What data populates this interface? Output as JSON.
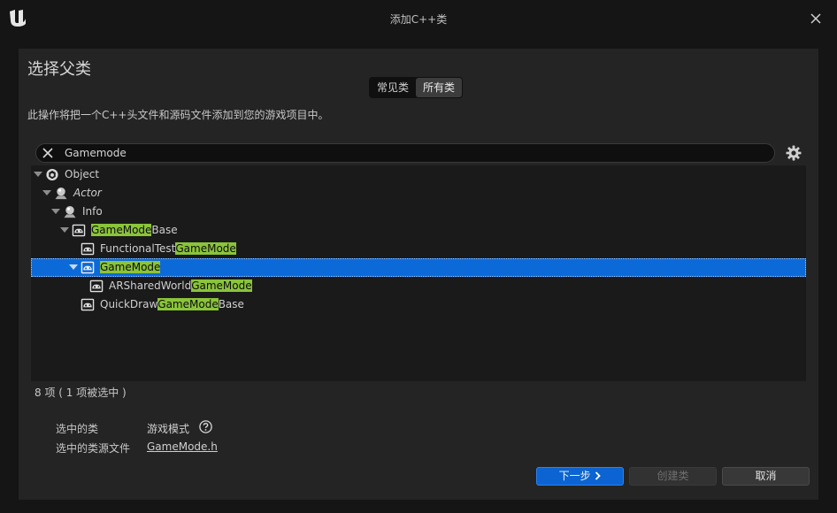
{
  "window": {
    "title": "添加C++类"
  },
  "heading": "选择父类",
  "tabs": [
    {
      "label": "常见类",
      "active": false
    },
    {
      "label": "所有类",
      "active": true
    }
  ],
  "description": "此操作将把一个C++头文件和源码文件添加到您的游戏项目中。",
  "search": {
    "value": "Gamemode"
  },
  "tree": {
    "object": {
      "label": "Object"
    },
    "actor": {
      "label": "Actor"
    },
    "info": {
      "label": "Info"
    },
    "gamemodebase": {
      "hl": "GameMode",
      "rest": "Base"
    },
    "functionaltest": {
      "pre": "FunctionalTest",
      "hl": "GameMode"
    },
    "gamemode": {
      "hl": "GameMode"
    },
    "arshared": {
      "pre": "ARSharedWorld",
      "hl": "GameMode"
    },
    "quickdraw": {
      "pre": "QuickDraw",
      "hl": "GameMode",
      "rest": "Base"
    }
  },
  "status": "8 项 ( 1 项被选中 )",
  "info": {
    "selected_class_label": "选中的类",
    "selected_class_value": "游戏模式",
    "source_file_label": "选中的类源文件",
    "source_file_value": "GameMode.h"
  },
  "buttons": {
    "next": "下一步",
    "create": "创建类",
    "cancel": "取消"
  },
  "colors": {
    "accent": "#0c6ad8",
    "highlight": "#8ac43a",
    "panel": "#242424",
    "background": "#151515"
  }
}
